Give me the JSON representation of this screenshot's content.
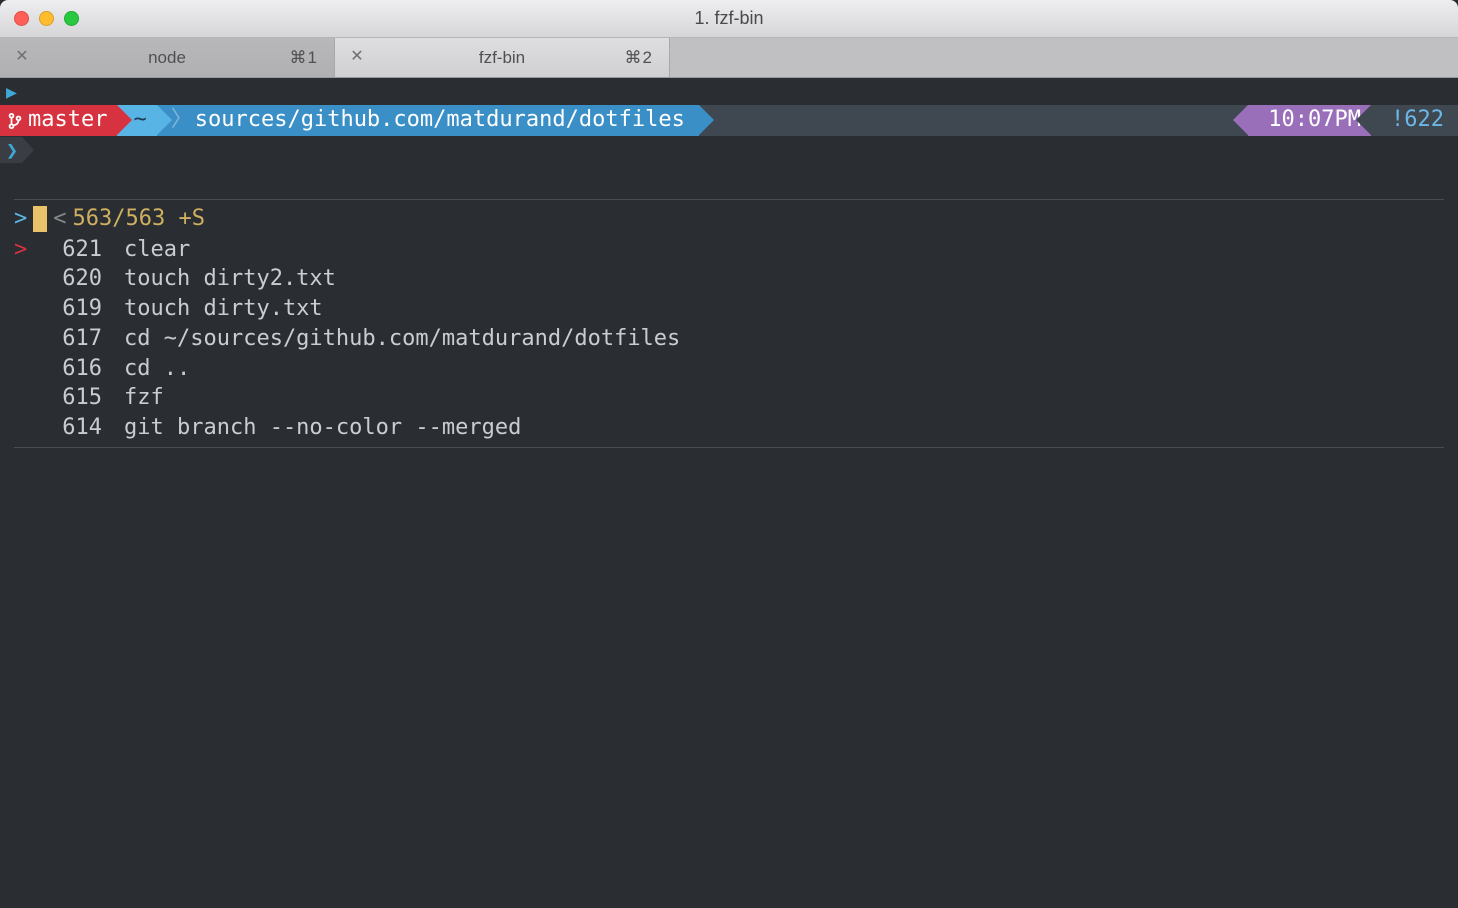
{
  "window": {
    "title": "1. fzf-bin"
  },
  "tabs": [
    {
      "label": "node",
      "shortcut": "⌘1",
      "active": false
    },
    {
      "label": "fzf-bin",
      "shortcut": "⌘2",
      "active": true
    }
  ],
  "prompt": {
    "branch": "master",
    "home": "~",
    "path": "sources/github.com/matdurand/dotfiles",
    "time": "10:07PM",
    "history_badge": "!622",
    "chevron": "❯"
  },
  "fzf": {
    "prompt_caret": ">",
    "less_than": "<",
    "match_counts": "563/563 +S",
    "results": [
      {
        "selected": true,
        "num": "621",
        "cmd": "clear"
      },
      {
        "selected": false,
        "num": "620",
        "cmd": "touch dirty2.txt"
      },
      {
        "selected": false,
        "num": "619",
        "cmd": "touch dirty.txt"
      },
      {
        "selected": false,
        "num": "617",
        "cmd": "cd ~/sources/github.com/matdurand/dotfiles"
      },
      {
        "selected": false,
        "num": "616",
        "cmd": "cd .."
      },
      {
        "selected": false,
        "num": "615",
        "cmd": "fzf"
      },
      {
        "selected": false,
        "num": "614",
        "cmd": "git branch --no-color --merged"
      }
    ]
  }
}
